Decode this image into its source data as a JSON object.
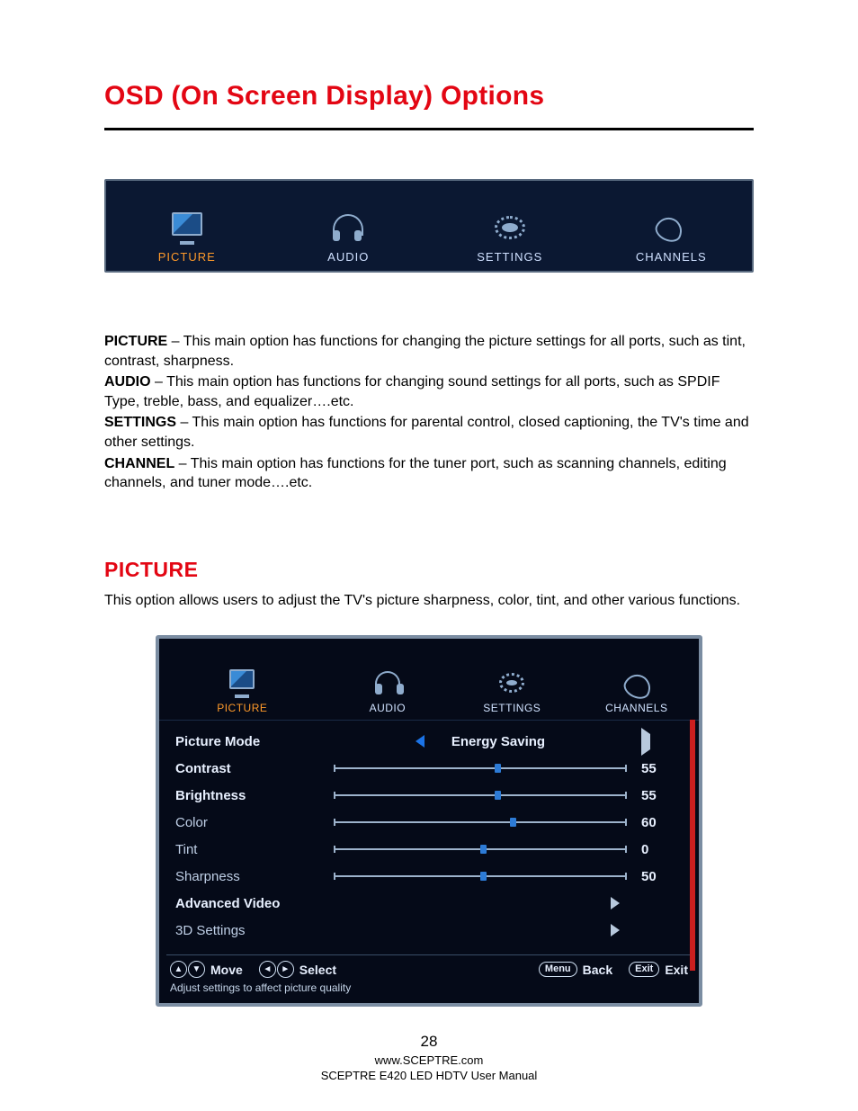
{
  "title": "OSD (On Screen Display) Options",
  "osd_tabs": {
    "picture": "PICTURE",
    "audio": "AUDIO",
    "settings": "SETTINGS",
    "channels": "CHANNELS"
  },
  "descriptions": {
    "picture_label": "PICTURE",
    "picture_text": " – This main option has functions for changing the picture settings for all ports, such as tint, contrast, sharpness.",
    "audio_label": "AUDIO",
    "audio_text": " – This main option has functions for changing sound settings for all ports, such as SPDIF Type, treble, bass, and equalizer….etc.",
    "settings_label": "SETTINGS",
    "settings_text": " – This main option has functions for parental control, closed captioning, the TV's time and other settings.",
    "channel_label": "CHANNEL",
    "channel_text": " – This main option has functions for the tuner port, such as scanning channels, editing channels, and tuner mode….etc."
  },
  "section_heading": "PICTURE",
  "section_intro": "This option allows users to adjust the TV's picture sharpness, color, tint, and other various functions.",
  "menu": {
    "picture_mode_label": "Picture Mode",
    "picture_mode_value": "Energy Saving",
    "items": {
      "contrast": {
        "label": "Contrast",
        "value": "55",
        "pos": 55
      },
      "brightness": {
        "label": "Brightness",
        "value": "55",
        "pos": 55
      },
      "color": {
        "label": "Color",
        "value": "60",
        "pos": 60
      },
      "tint": {
        "label": "Tint",
        "value": "0",
        "pos": 50
      },
      "sharpness": {
        "label": "Sharpness",
        "value": "50",
        "pos": 50
      }
    },
    "advanced_video": "Advanced Video",
    "three_d": "3D Settings"
  },
  "navbar": {
    "move": "Move",
    "select": "Select",
    "menu_key": "Menu",
    "back": "Back",
    "exit_key": "Exit",
    "exit": "Exit",
    "hint": "Adjust settings to affect picture quality"
  },
  "footer": {
    "page": "28",
    "url": "www.SCEPTRE.com",
    "manual": "SCEPTRE E420 LED HDTV User Manual"
  }
}
